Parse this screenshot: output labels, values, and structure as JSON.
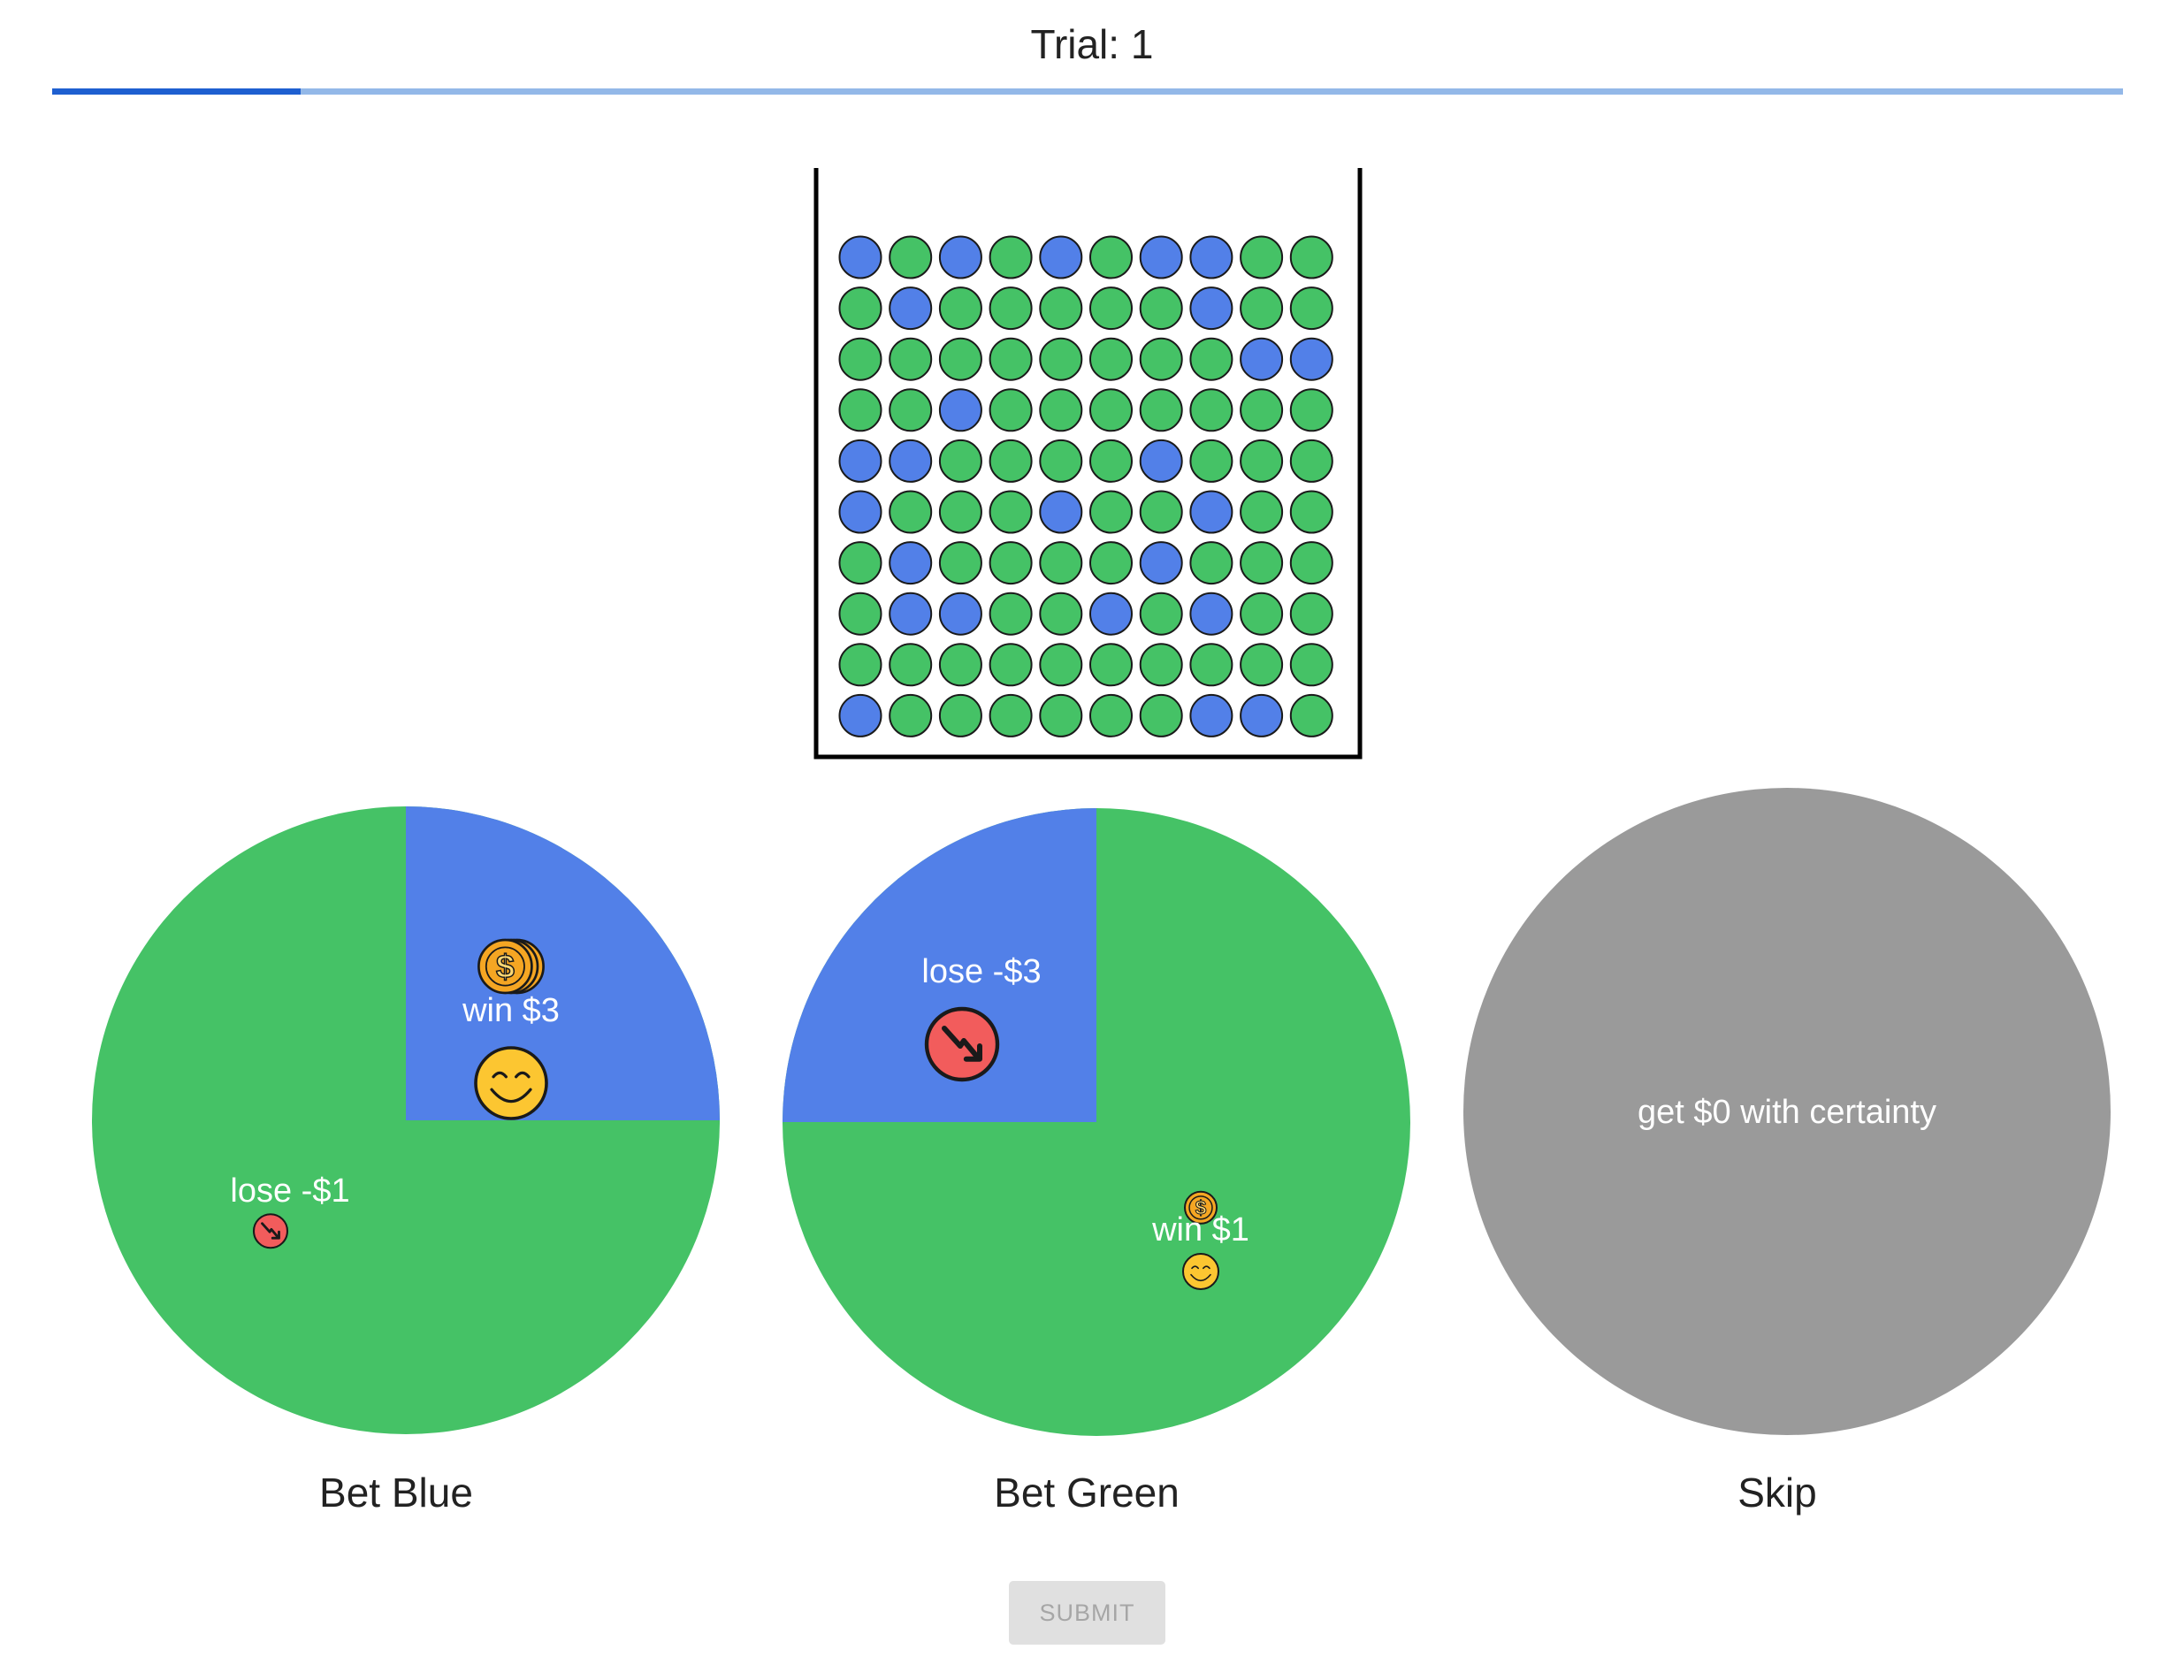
{
  "header": {
    "trial_label": "Trial: 1",
    "progress_fraction": 0.12
  },
  "urn": {
    "colors": {
      "B": "#5280e8",
      "G": "#45c266"
    },
    "rows": [
      "BGBGBGBBGG",
      "GBGGGGGBGG",
      "GGGGGGGGBB",
      "GGBGGGGGGG",
      "BBGGGGBGGG",
      "BGGGBGGBGG",
      "GBGGGGBGGG",
      "GBBGGBGBGG",
      "GGGGGGGGGG",
      "BGGGGGGBBG"
    ]
  },
  "options": [
    {
      "label": "Bet Blue",
      "blue_fraction": 0.25,
      "blue_outcome": {
        "text": "win $3",
        "kind": "win",
        "coins": 3
      },
      "green_outcome": {
        "text": "lose -$1",
        "kind": "lose",
        "coins": 1
      }
    },
    {
      "label": "Bet Green",
      "blue_fraction": 0.25,
      "blue_outcome": {
        "text": "lose -$3",
        "kind": "lose",
        "coins": 3
      },
      "green_outcome": {
        "text": "win $1",
        "kind": "win",
        "coins": 1
      }
    },
    {
      "label": "Skip",
      "sure_outcome": {
        "text": "get $0 with certainty"
      }
    }
  ],
  "colors": {
    "blue": "#5280e8",
    "green": "#45c266",
    "gray": "#9a9a9a",
    "coin": "#f5a623",
    "smiley": "#fcc631",
    "lose_icon": "#f25c5c",
    "progress_fill": "#1e5fd0",
    "progress_track": "#93b8e8"
  },
  "icons": {
    "win": [
      "coin-stack-icon",
      "smiley-face-icon"
    ],
    "lose": "trend-down-icon"
  },
  "submit": {
    "label": "SUBMIT",
    "enabled": false
  }
}
